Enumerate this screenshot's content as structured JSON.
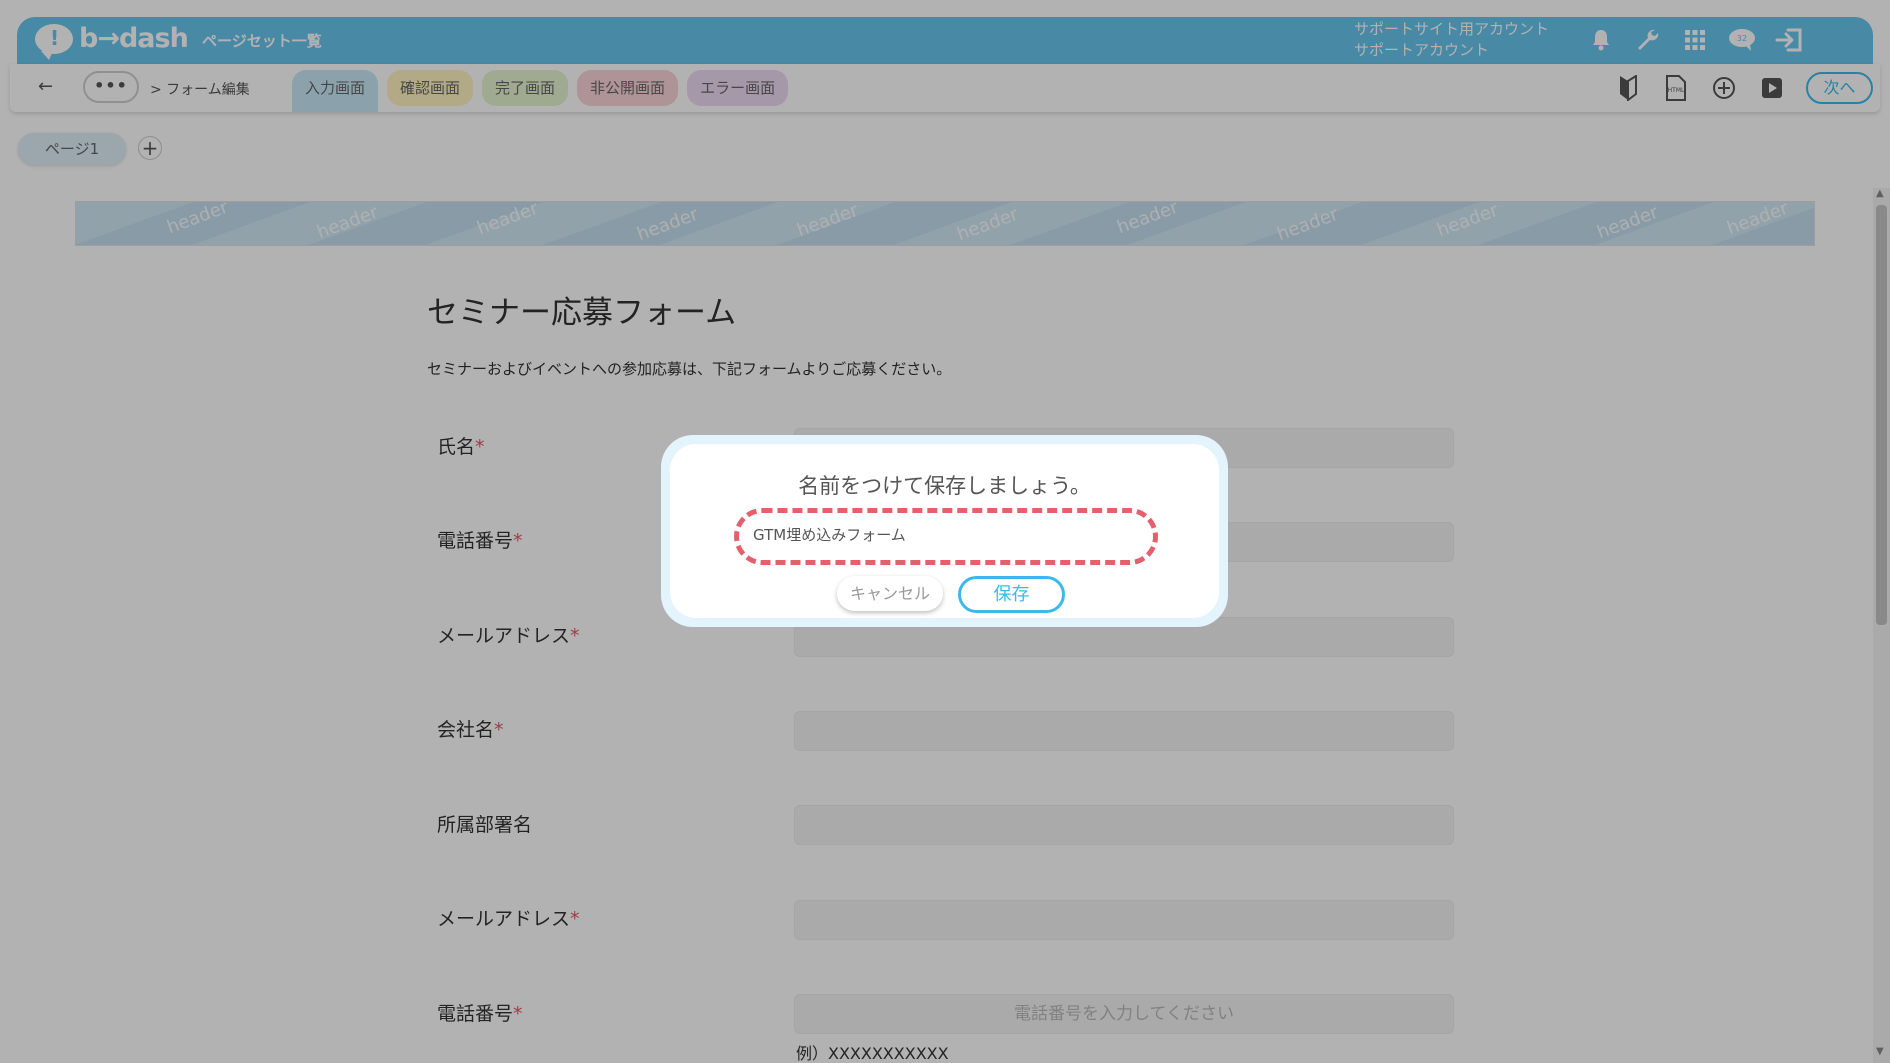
{
  "topbar": {
    "logo_text": "b→dash",
    "page_set_link": "ページセット一覧",
    "account_line1": "サポートサイト用アカウント",
    "account_line2": "サポートアカウント",
    "icons": [
      "bell-icon",
      "wrench-icon",
      "grid-icon",
      "chat-icon",
      "logout-icon"
    ]
  },
  "subbar": {
    "back": "←",
    "more": "•••",
    "breadcrumb": "> フォーム編集",
    "tabs": [
      {
        "label": "入力画面",
        "color": "#c7e9f8"
      },
      {
        "label": "確認画面",
        "color": "#fff3c2"
      },
      {
        "label": "完了画面",
        "color": "#e4f4cf"
      },
      {
        "label": "非公開画面",
        "color": "#fbd4d9"
      },
      {
        "label": "エラー画面",
        "color": "#ecdaf2"
      }
    ],
    "next_label": "次へ"
  },
  "pages": {
    "page_label": "ページ1",
    "add": "+"
  },
  "content": {
    "banner_text": "header",
    "form_title": "セミナー応募フォーム",
    "form_desc": "セミナーおよびイベントへの参加応募は、下記フォームよりご応募ください。",
    "fields": [
      {
        "label": "氏名",
        "required": "*",
        "placeholder": ""
      },
      {
        "label": "電話番号",
        "required": "*",
        "placeholder": ""
      },
      {
        "label": "メールアドレス",
        "required": "*",
        "placeholder": ""
      },
      {
        "label": "会社名",
        "required": "*",
        "placeholder": ""
      },
      {
        "label": "所属部署名",
        "required": "",
        "placeholder": ""
      },
      {
        "label": "メールアドレス",
        "required": "*",
        "placeholder": ""
      },
      {
        "label": "電話番号",
        "required": "*",
        "placeholder": "電話番号を入力してください"
      }
    ],
    "example": "例）XXXXXXXXXXX"
  },
  "modal": {
    "title": "名前をつけて保存しましょう。",
    "input_value": "GTM埋め込みフォーム",
    "cancel": "キャンセル",
    "save": "保存"
  },
  "colors": {
    "brand": "#67c5ed",
    "accent": "#3cb9ec",
    "required": "#e45664",
    "highlight": "#e4606c"
  }
}
